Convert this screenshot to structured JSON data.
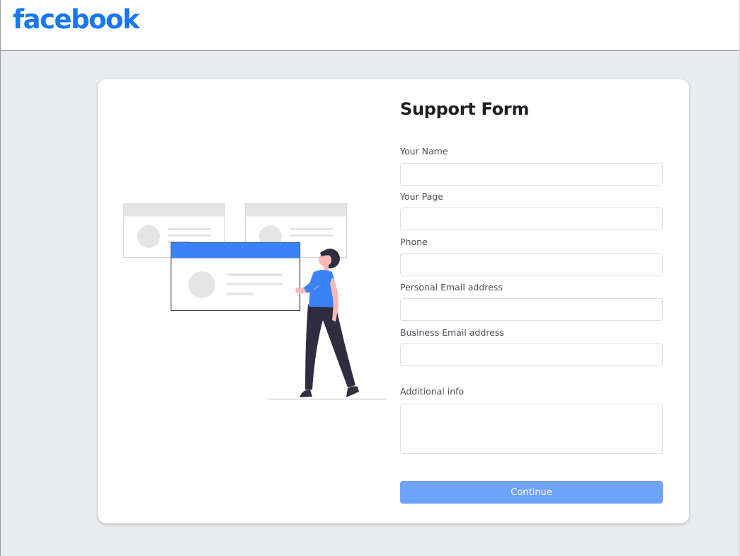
{
  "header": {
    "logo_text": "facebook"
  },
  "form": {
    "title": "Support Form",
    "fields": [
      {
        "label": "Your Name",
        "value": "",
        "placeholder": ""
      },
      {
        "label": "Your Page",
        "value": "",
        "placeholder": ""
      },
      {
        "label": "Phone",
        "value": "",
        "placeholder": ""
      },
      {
        "label": "Personal Email address",
        "value": "",
        "placeholder": ""
      },
      {
        "label": "Business Email address",
        "value": "",
        "placeholder": ""
      }
    ],
    "additional_info": {
      "label": "Additional info",
      "value": "",
      "placeholder": ""
    },
    "submit_label": "Continue"
  },
  "colors": {
    "brand": "#1877f2",
    "button": "#6ea3fb",
    "background": "#e9ebee",
    "illustration_accent": "#3b82f6",
    "illustration_dark": "#2f2e41"
  },
  "illustration": {
    "icon": "support-person-illustration"
  }
}
